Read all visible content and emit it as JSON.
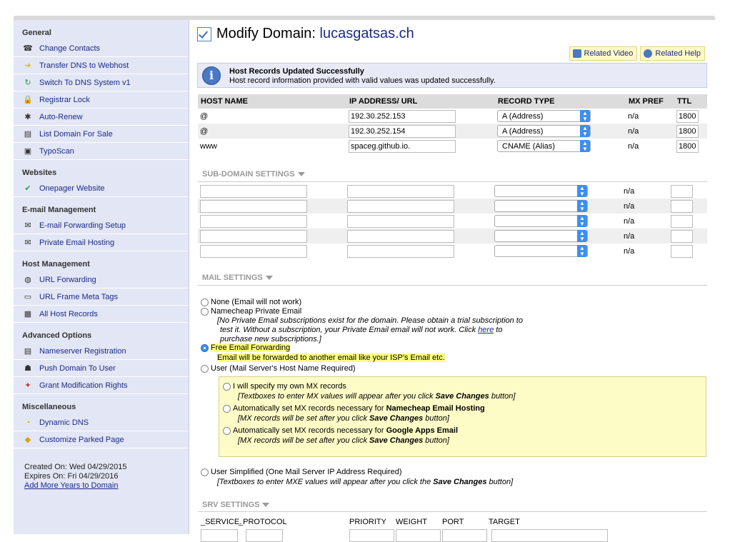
{
  "sidebar": {
    "groups": [
      {
        "title": "General",
        "items": [
          {
            "label": "Change Contacts",
            "icon": "contacts-icon"
          },
          {
            "label": "Transfer DNS to Webhost",
            "icon": "arrow-right-icon"
          },
          {
            "label": "Switch To DNS System v1",
            "icon": "refresh-icon"
          },
          {
            "label": "Registrar Lock",
            "icon": "lock-icon"
          },
          {
            "label": "Auto-Renew",
            "icon": "auto-renew-icon"
          },
          {
            "label": "List Domain For Sale",
            "icon": "sale-list-icon"
          },
          {
            "label": "TypoScan",
            "icon": "typoscan-icon"
          }
        ]
      },
      {
        "title": "Websites",
        "items": [
          {
            "label": "Onepager Website",
            "icon": "checkmark-icon"
          }
        ]
      },
      {
        "title": "E-mail Management",
        "items": [
          {
            "label": "E-mail Forwarding Setup",
            "icon": "email-forward-icon"
          },
          {
            "label": "Private Email Hosting",
            "icon": "envelope-icon"
          }
        ]
      },
      {
        "title": "Host Management",
        "items": [
          {
            "label": "URL Forwarding",
            "icon": "globe-icon"
          },
          {
            "label": "URL Frame Meta Tags",
            "icon": "frame-icon"
          },
          {
            "label": "All Host Records",
            "icon": "host-records-icon"
          }
        ]
      },
      {
        "title": "Advanced Options",
        "items": [
          {
            "label": "Nameserver Registration",
            "icon": "nameserver-icon"
          },
          {
            "label": "Push Domain To User",
            "icon": "push-user-icon"
          },
          {
            "label": "Grant Modification Rights",
            "icon": "grant-rights-icon"
          }
        ]
      },
      {
        "title": "Miscellaneous",
        "items": [
          {
            "label": "Dynamic DNS",
            "icon": "dynamic-dns-icon"
          },
          {
            "label": "Customize Parked Page",
            "icon": "parked-page-icon"
          }
        ]
      }
    ],
    "created_on": "Created On: Wed 04/29/2015",
    "expires_on": "Expires On: Fri 04/29/2016",
    "add_years": "Add More Years to Domain"
  },
  "header": {
    "title_prefix": "Modify Domain:",
    "domain": "lucasgatsas.ch",
    "related_video": "Related Video",
    "related_help": "Related Help"
  },
  "notice": {
    "title": "Host Records Updated Successfully",
    "message": "Host record information provided with valid values was updated successfully."
  },
  "host_table": {
    "columns": [
      "HOST NAME",
      "IP ADDRESS/ URL",
      "RECORD TYPE",
      "MX PREF",
      "TTL"
    ],
    "rows": [
      {
        "host": "@",
        "ip": "192.30.252.153",
        "type": "A (Address)",
        "mx": "n/a",
        "ttl": "1800"
      },
      {
        "host": "@",
        "ip": "192.30.252.154",
        "type": "A (Address)",
        "mx": "n/a",
        "ttl": "1800"
      },
      {
        "host": "www",
        "ip": "spaceg.github.io.",
        "type": "CNAME (Alias)",
        "mx": "n/a",
        "ttl": "1800"
      }
    ]
  },
  "subdomain": {
    "title": "SUB-DOMAIN SETTINGS",
    "mx": "n/a"
  },
  "mail": {
    "title": "MAIL SETTINGS",
    "opt_none": "None (Email will not work)",
    "opt_private": "Namecheap Private Email",
    "private_note_1": "[No Private Email subscriptions exist for the domain. Please obtain a trial subscription to",
    "private_note_2a": "test it. Without a subscription, your Private Email email will not work. Click ",
    "private_note_link": "here",
    "private_note_2b": " to",
    "private_note_3": "purchase new subscriptions.]",
    "opt_free": "Free Email Forwarding",
    "free_note": "Email will be forwarded to another email like your ISP's Email etc.",
    "opt_user": "User (Mail Server's Host Name Required)",
    "sub_own": "I will specify my own MX records",
    "sub_own_note_a": "[Textboxes to enter MX values will appear after you click ",
    "save_changes": "Save Changes",
    "sub_own_note_b": " button]",
    "sub_nc_a": "Automatically set MX records necessary for ",
    "sub_nc_b": "Namecheap Email Hosting",
    "mx_note_a": "[MX records will be set after you click ",
    "mx_note_b": " button]",
    "sub_google_a": "Automatically set MX records necessary for ",
    "sub_google_b": "Google Apps Email",
    "opt_simple": "User Simplified (One Mail Server IP Address Required)",
    "simple_note_a": "[Textboxes to enter MXE values will appear after you click the ",
    "simple_note_b": " button]"
  },
  "srv": {
    "title": "SRV SETTINGS",
    "service": "_SERVICE.",
    "protocol": "_PROTOCOL",
    "priority": "PRIORITY",
    "weight": "WEIGHT",
    "port": "PORT",
    "target": "TARGET"
  }
}
